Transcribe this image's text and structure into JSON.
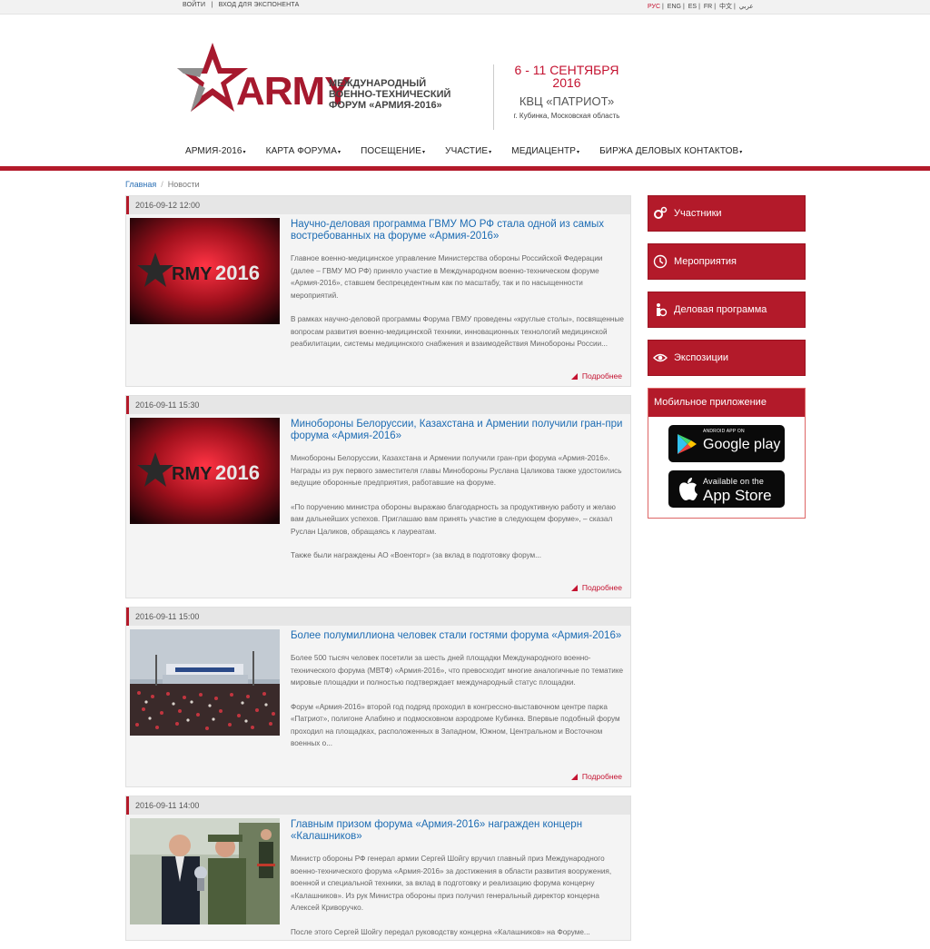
{
  "topbar": {
    "login": "ВОЙТИ",
    "exhibitor": "ВХОД ДЛЯ ЭКСПОНЕНТА",
    "languages": [
      "РУС",
      "ENG",
      "ES",
      "FR",
      "中文",
      "عربي"
    ]
  },
  "header": {
    "logo_word": "ARMY",
    "forum_line1": "Международный",
    "forum_line2": "военно-технический",
    "forum_line3": "форум «Армия-2016»",
    "dates": "6 - 11 СЕНТЯБРЯ 2016",
    "venue": "КВЦ «ПАТРИОТ»",
    "city": "г. Кубинка, Московская область"
  },
  "nav": [
    "АРМИЯ-2016",
    "КАРТА ФОРУМА",
    "ПОСЕЩЕНИЕ",
    "УЧАСТИЕ",
    "МЕДИАЦЕНТР",
    "БИРЖА ДЕЛОВЫХ КОНТАКТОВ"
  ],
  "breadcrumb": {
    "home": "Главная",
    "current": "Новости"
  },
  "more_label": "Подробнее",
  "news": [
    {
      "date": "2016-09-12 12:00",
      "title": "Научно-деловая программа ГВМУ МО РФ стала одной из самых востребованных на форуме «Армия-2016»",
      "paragraphs": [
        "Главное военно-медицинское управление Министерства обороны Российской Федерации (далее – ГВМУ МО РФ) приняло участие в Международном военно-техническом форуме «Армия-2016», ставшем беспрецедентным как по масштабу, так и по насыщенности мероприятий.",
        "В рамках научно-деловой программы Форума ГВМУ проведены «круглые столы», посвященные вопросам развития военно-медицинской техники, инновационных технологий медицинской реабилитации, системы медицинского снабжения и взаимодействия Минобороны России..."
      ],
      "image": "army-2016-logo"
    },
    {
      "date": "2016-09-11 15:30",
      "title": "Минобороны Белоруссии, Казахстана и Армении получили гран-при форума «Армия-2016»",
      "paragraphs": [
        "Минобороны Белоруссии, Казахстана и Армении получили гран-при форума «Армия-2016». Награды из рук первого заместителя главы Минобороны Руслана Цаликова также удостоились ведущие оборонные предприятия, работавшие на форуме.",
        "«По поручению министра обороны выражаю благодарность за продуктивную работу и желаю вам дальнейших успехов. Приглашаю вам принять участие в следующем форуме», – сказал Руслан Цаликов, обращаясь к лауреатам.",
        "Также были награждены АО «Военторг» (за вклад в подготовку форум..."
      ],
      "image": "army-2016-logo"
    },
    {
      "date": "2016-09-11 15:00",
      "title": "Более полумиллиона человек стали гостями форума «Армия-2016»",
      "paragraphs": [
        "Более 500 тысяч человек посетили за шесть дней площадки Международного военно-технического форума (МВТФ) «Армия-2016», что превосходит многие аналогичные по тематике мировые площадки и полностью подтверждает международный статус площадки.",
        "Форум «Армия-2016» второй год подряд проходил в конгрессно-выставочном центре парка «Патриот», полигоне Алабино и подмосковном аэродроме Кубинка. Впервые подобный форум проходил на площадках, расположенных в Западном, Южном, Центральном и Восточном военных о..."
      ],
      "image": "crowd-photo"
    },
    {
      "date": "2016-09-11 14:00",
      "title": "Главным призом форума «Армия-2016» награжден концерн «Калашников»",
      "paragraphs": [
        "Министр обороны РФ генерал армии Сергей Шойгу вручил главный приз Международного военно-технического форума «Армия-2016» за достижения в области развития вооружения, военной и специальной техники, за вклад в подготовку и реализацию форума концерну «Калашников». Из рук Министра обороны приз получил генеральный директор концерна Алексей Криворучко.",
        "После этого Сергей Шойгу передал руководству концерна «Калашников» на Форуме..."
      ],
      "image": "award-photo"
    }
  ],
  "sidebar": {
    "buttons": [
      {
        "label": "Участники",
        "icon": "gears-icon"
      },
      {
        "label": "Мероприятия",
        "icon": "clock-icon"
      },
      {
        "label": "Деловая программа",
        "icon": "briefcase-icon"
      },
      {
        "label": "Экспозиции",
        "icon": "eye-icon"
      }
    ],
    "mobile_title": "Мобильное приложение",
    "google_small": "ANDROID APP ON",
    "google_big": "Google play",
    "apple_small": "Available on the",
    "apple_big": "App Store"
  },
  "colors": {
    "accent": "#b31a2a",
    "link": "#1d6cb3"
  }
}
